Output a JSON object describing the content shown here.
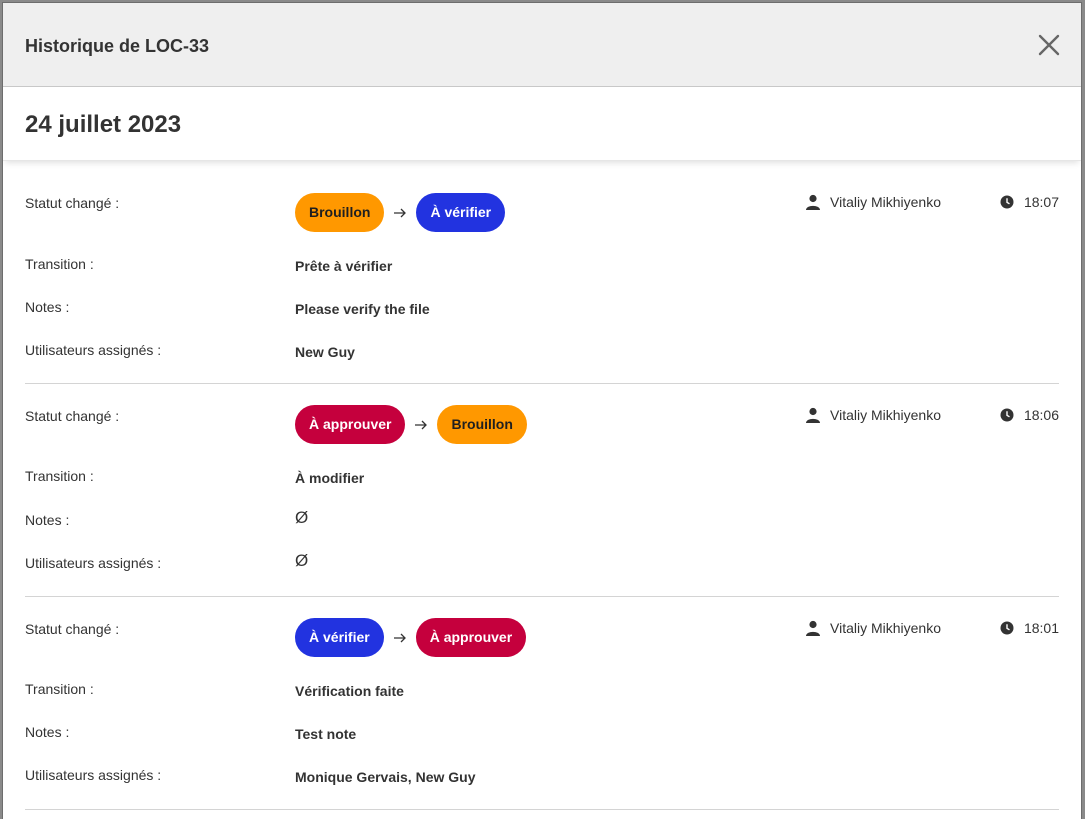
{
  "modal": {
    "title": "Historique de LOC-33",
    "close_icon": "close-icon"
  },
  "date": "24 juillet 2023",
  "labels": {
    "status": "Statut changé :",
    "transition": "Transition :",
    "notes": "Notes :",
    "assigned": "Utilisateurs assignés :"
  },
  "entries": [
    {
      "from": {
        "label": "Brouillon",
        "color": "#ff9800"
      },
      "to": {
        "label": "À vérifier",
        "color": "#2233e0"
      },
      "user": "Vitaliy Mikhiyenko",
      "time": "18:07",
      "transition": "Prête à vérifier",
      "notes": "Please verify the file",
      "assigned": "New Guy"
    },
    {
      "from": {
        "label": "À approuver",
        "color": "#c5003d"
      },
      "to": {
        "label": "Brouillon",
        "color": "#ff9800"
      },
      "user": "Vitaliy Mikhiyenko",
      "time": "18:06",
      "transition": "À modifier",
      "notes": "Ø",
      "assigned": "Ø"
    },
    {
      "from": {
        "label": "À vérifier",
        "color": "#2233e0"
      },
      "to": {
        "label": "À approuver",
        "color": "#c5003d"
      },
      "user": "Vitaliy Mikhiyenko",
      "time": "18:01",
      "transition": "Vérification faite",
      "notes": "Test note",
      "assigned": "Monique Gervais, New Guy"
    }
  ]
}
